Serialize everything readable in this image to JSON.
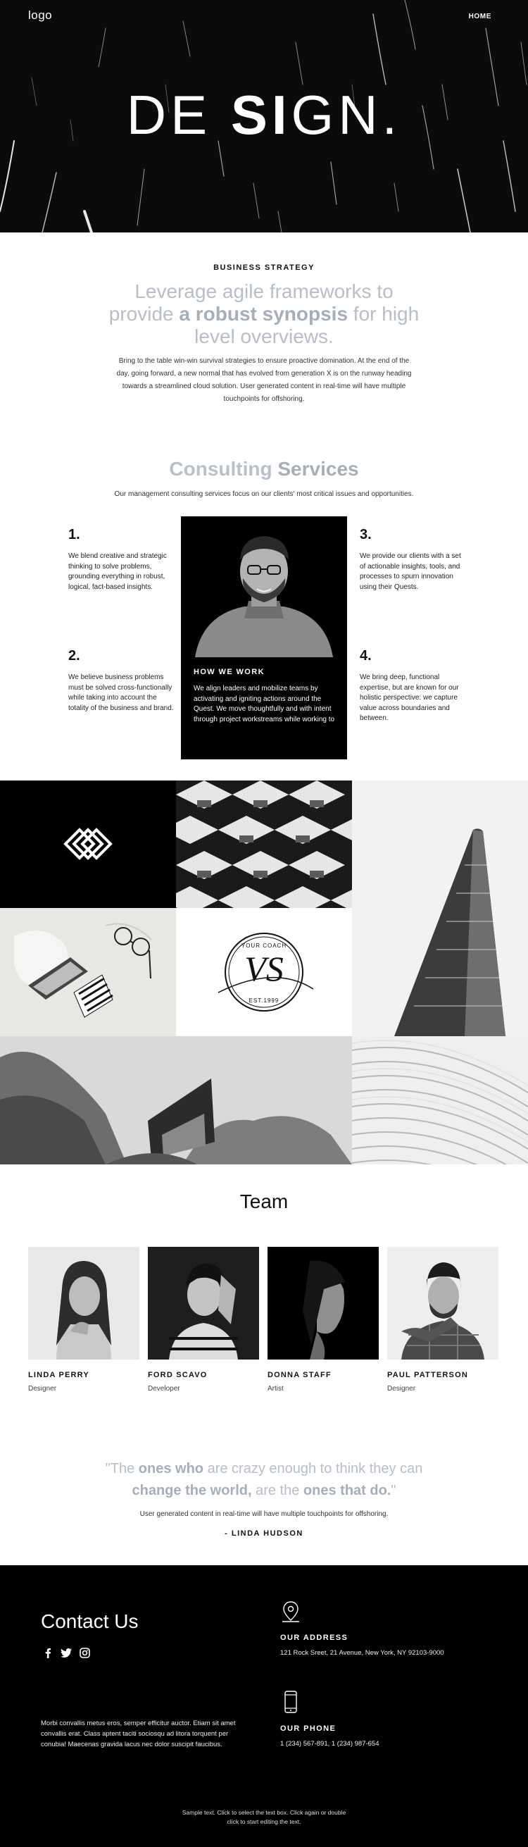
{
  "header": {
    "logo": "logo",
    "nav_home": "HOME",
    "hero_title_pre": "DE ",
    "hero_title_bold": "SI",
    "hero_title_post": "GN."
  },
  "strategy": {
    "label": "BUSINESS STRATEGY",
    "lead_1": "Leverage agile frameworks to provide ",
    "lead_bold": "a robust synopsis",
    "lead_2": " for high level overviews.",
    "paragraph": "Bring to the table win-win survival strategies to ensure proactive domination. At the end of the day, going forward, a new normal that has evolved from generation X is on the runway heading towards a streamlined cloud solution. User generated content in real-time will have multiple touchpoints for offshoring."
  },
  "services": {
    "title_light": "Consulting ",
    "title_bold": "Services",
    "subtitle": "Our management consulting services focus on our clients' most critical issues and opportunities.",
    "items": [
      {
        "num": "1.",
        "text": "We blend creative and strategic thinking to solve problems, grounding everything in robust, logical, fact-based insights."
      },
      {
        "num": "2.",
        "text": "We believe business problems must be solved cross-functionally while taking into account the totality of the business and brand."
      },
      {
        "num": "3.",
        "text": "We provide our clients with a set of actionable insights, tools, and processes to spurn innovation using their Quests."
      },
      {
        "num": "4.",
        "text": "We bring deep, functional expertise, but are known for our holistic perspective: we capture value across boundaries and between."
      }
    ],
    "how": {
      "title": "HOW WE WORK",
      "text": "We align leaders and mobilize teams by activating and igniting actions around the Quest. We move thoughtfully and with intent through project workstreams while working to"
    }
  },
  "mosaic": {
    "badge_top": "YOUR COACH",
    "badge_bottom": "EST.1999",
    "badge_monogram": "VS"
  },
  "team": {
    "title": "Team",
    "members": [
      {
        "name": "LINDA PERRY",
        "role": "Designer"
      },
      {
        "name": "FORD SCAVO",
        "role": "Developer"
      },
      {
        "name": "DONNA STAFF",
        "role": "Artist"
      },
      {
        "name": "PAUL PATTERSON",
        "role": "Designer"
      }
    ]
  },
  "quote": {
    "p1": "\"The ",
    "b1": "ones who",
    "p2": " are crazy enough to think they can ",
    "b2": "change the world,",
    "p3": " are the ",
    "b3": "ones that do.",
    "p4": "\"",
    "sub": "User generated content in real-time will have multiple touchpoints for offshoring.",
    "author": "- LINDA HUDSON"
  },
  "footer": {
    "contact_title": "Contact Us",
    "socials": [
      "facebook-icon",
      "twitter-icon",
      "instagram-icon"
    ],
    "text": "Morbi convallis metus eros, semper efficitur auctor. Etiam sit amet convallis erat. Class aptent taciti sociosqu ad litora torquent per conubia! Maecenas gravida lacus nec dolor suscipit faucibus.",
    "address_title": "OUR ADDRESS",
    "address": "121 Rock Sreet, 21 Avenue, New York, NY 92103-9000",
    "phone_title": "OUR PHONE",
    "phone": "1 (234) 567-891, 1 (234) 987-654",
    "bottom_note_1": "Sample text. Click to select the text box. Click again or double",
    "bottom_note_2": "click to start editing the text."
  }
}
